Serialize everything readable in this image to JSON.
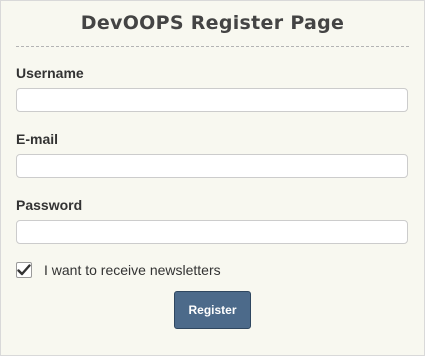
{
  "form": {
    "title": "DevOOPS Register Page",
    "fields": [
      {
        "label": "Username",
        "value": "",
        "placeholder": ""
      },
      {
        "label": "E-mail",
        "value": "",
        "placeholder": ""
      },
      {
        "label": "Password",
        "value": "",
        "placeholder": ""
      }
    ],
    "newsletter": {
      "label": "I want to receive newsletters",
      "checked": true,
      "icon": "checkmark-icon"
    },
    "submit_label": "Register",
    "colors": {
      "background": "#f8f8f0",
      "button": "#4c6a8a",
      "text": "#333333"
    }
  }
}
